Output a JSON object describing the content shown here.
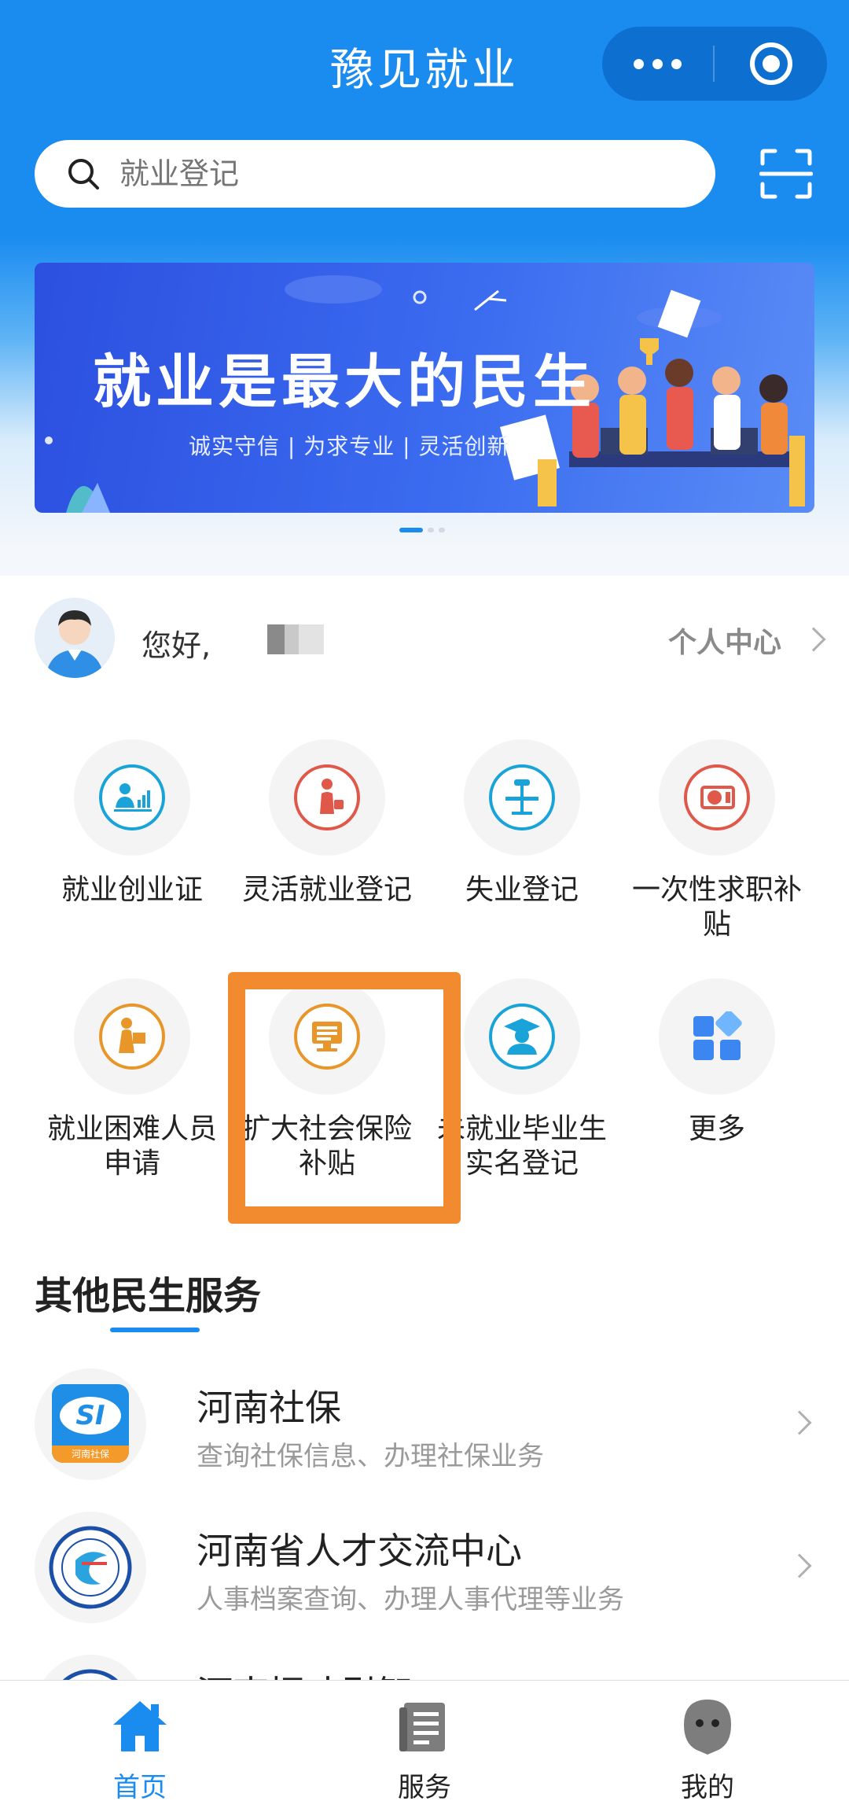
{
  "header": {
    "title": "豫见就业"
  },
  "search": {
    "placeholder": "就业登记"
  },
  "banner": {
    "title": "就业是最大的民生",
    "subtitle": "诚实守信 | 为求专业 | 灵活创新"
  },
  "user": {
    "greeting": "您好,",
    "center_label": "个人中心"
  },
  "services": [
    {
      "label": "就业创业证",
      "icon": "employment-chart-icon",
      "color": "#1aa3d9"
    },
    {
      "label": "灵活就业登记",
      "icon": "flexible-worker-icon",
      "color": "#e0584a"
    },
    {
      "label": "失业登记",
      "icon": "unemployment-desk-icon",
      "color": "#1aa3d9"
    },
    {
      "label": "一次性求职补贴",
      "icon": "money-subsidy-icon",
      "color": "#e0584a"
    },
    {
      "label": "就业困难人员申请",
      "icon": "difficulty-person-icon",
      "color": "#e8962a"
    },
    {
      "label": "扩大社会保险补贴",
      "icon": "computer-insurance-icon",
      "color": "#e8962a"
    },
    {
      "label": "未就业毕业生实名登记",
      "icon": "graduate-icon",
      "color": "#1aa3d9"
    },
    {
      "label": "更多",
      "icon": "more-grid-icon",
      "color": "#3b86f0"
    }
  ],
  "other": {
    "title": "其他民生服务",
    "items": [
      {
        "name": "河南社保",
        "desc": "查询社保信息、办理社保业务",
        "logo": "henan-social-security-logo",
        "logo_text": "SI",
        "logo_sub": "河南社保"
      },
      {
        "name": "河南省人才交流中心",
        "desc": "人事档案查询、办理人事代理等业务",
        "logo": "talent-exchange-logo"
      },
      {
        "name": "河南招才引智",
        "desc": "",
        "logo": "talent-recruit-logo"
      }
    ]
  },
  "tabs": [
    {
      "label": "首页",
      "icon": "home-icon",
      "active": true
    },
    {
      "label": "服务",
      "icon": "service-list-icon",
      "active": false
    },
    {
      "label": "我的",
      "icon": "profile-icon",
      "active": false
    }
  ],
  "colors": {
    "primary": "#1a8cf0",
    "highlight": "#f28a30"
  }
}
